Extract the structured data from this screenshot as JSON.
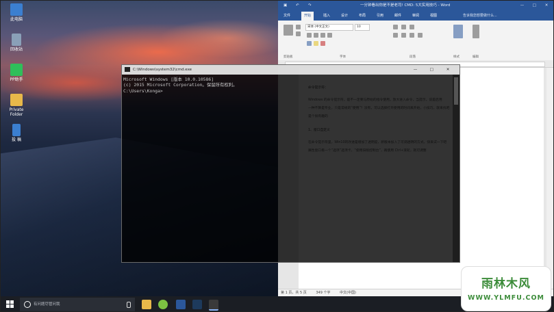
{
  "desktop": {
    "icons": [
      {
        "label": "此电脑",
        "color": "#3b7fd0"
      },
      {
        "label": "回收站",
        "color": "#8aa0b8"
      },
      {
        "label": "PP助手",
        "color": "#2fbf5a"
      },
      {
        "label": "Private Folder",
        "color": "#e8b84a"
      },
      {
        "label": "投 稿",
        "color": "#3b7fd0"
      }
    ]
  },
  "word": {
    "title": "一分钟看出你是不是老司! CMD: 5大实用技巧 - Word",
    "window_controls": [
      "—",
      "□",
      "✕"
    ],
    "tabs": [
      "文件",
      "开始",
      "插入",
      "设计",
      "布局",
      "引用",
      "邮件",
      "审阅",
      "视图"
    ],
    "active_tab": "开始",
    "tell_me": "告诉我您想要做什么...",
    "ribbon": {
      "font_name": "宋体 (中文正文)",
      "font_size": "10",
      "groups": [
        "剪贴板",
        "字体",
        "段落",
        "样式",
        "编辑"
      ]
    },
    "document_lines": [
      "命令提示符：",
      "Windows 的命令提示符，是不一定要与原始的指令使用，放大进入命令，当提示，说是启用",
      "一种不算是专业，只是常规的“使用”？没有，可以选择打开使用的时间来开始，小技巧，就来找吧",
      "是个很有趣的",
      "1、窗口自定义",
      "在命令提示符里，Win10的改进是增加了透明度，新版本加入了可调透明的方式，快来试一下吧",
      "属性窗口看一个“选项”选项卡，“使用旧版控制台”，再使用 Ctrl+滚轮，就可调整"
    ],
    "status": {
      "page": "第 1 页，共 5 页",
      "words": "349 个字",
      "language": "中文(中国)"
    }
  },
  "cmd": {
    "title": "C:\\Windows\\system32\\cmd.exe",
    "window_controls": [
      "—",
      "□",
      "✕"
    ],
    "lines": [
      "Microsoft Windows [版本 10.0.10586]",
      "(c) 2015 Microsoft Corporation。保留所有权利。",
      "",
      "C:\\Users\\Konga>"
    ]
  },
  "taskbar": {
    "search_placeholder": "有问题尽管问我",
    "apps": [
      {
        "name": "file-explorer",
        "color": "#e8b84a"
      },
      {
        "name": "android-helper",
        "color": "#7cc242"
      },
      {
        "name": "word",
        "color": "#2b579a"
      },
      {
        "name": "photoshop",
        "color": "#1d3a5c"
      },
      {
        "name": "cmd",
        "color": "#3a3a3a"
      }
    ],
    "tray": "⌃  ▭  ◁)"
  },
  "watermark": {
    "line1": "雨林木风",
    "line2": "WWW.YLMFU.COM"
  }
}
